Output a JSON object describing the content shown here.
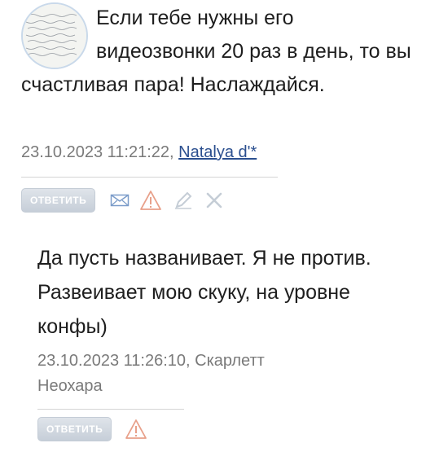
{
  "comment1": {
    "text": "Если тебе нужны его видеозвонки 20 раз в день, то вы счастливая пара! Наслаждайся.",
    "date": "23.10.2023 11:21:22, ",
    "author": "Natalya d'*",
    "reply_label": "ответить",
    "icons": [
      "avatar",
      "envelope-icon",
      "warning-icon",
      "edit-icon",
      "delete-icon"
    ]
  },
  "comment2": {
    "text": "Да пусть названивает. Я не против. Развеивает мою скуку, на уровне конфы)",
    "meta": "23.10.2023 11:26:10, Скарлетт Неохара",
    "reply_label": "ответить",
    "icons": [
      "warning-icon"
    ]
  },
  "colors": {
    "reply_button": "#c6ced8",
    "link": "#2b4f8f",
    "warning": "#e8a08a",
    "envelope": "#7b9cc9",
    "muted_icon": "#c5cdd6"
  }
}
